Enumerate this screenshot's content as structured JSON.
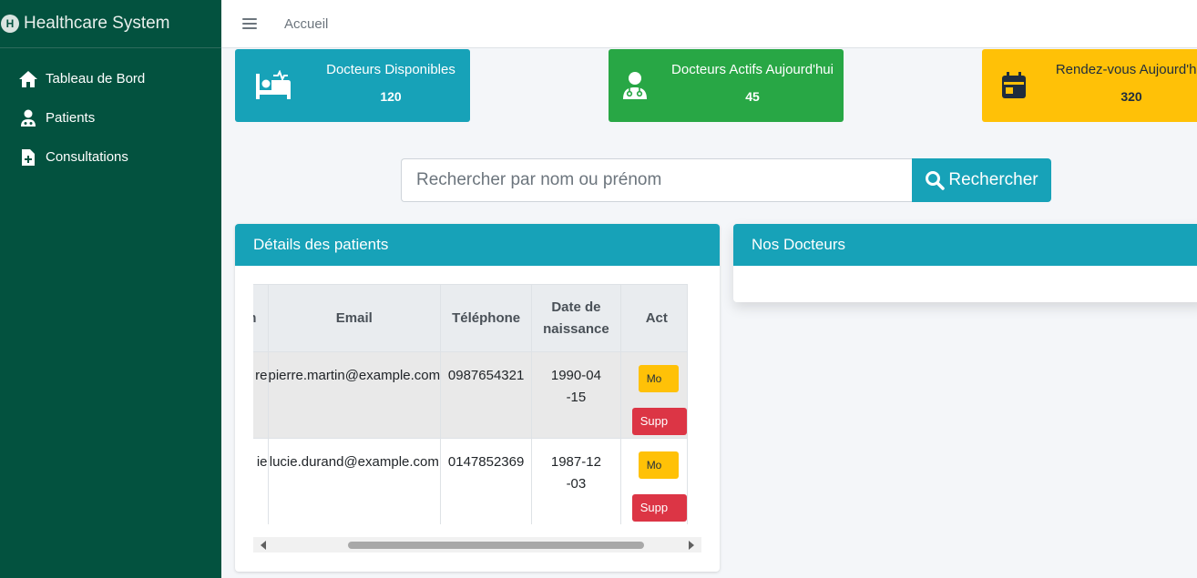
{
  "app": {
    "title": "Healthcare System",
    "logo_letter": "H"
  },
  "sidebar": {
    "items": [
      {
        "label": "Tableau de Bord",
        "icon": "home-icon"
      },
      {
        "label": "Patients",
        "icon": "user-doctor-icon"
      },
      {
        "label": "Consultations",
        "icon": "file-medical-icon"
      }
    ]
  },
  "topbar": {
    "menu_icon": "hamburger-icon",
    "home_label": "Accueil"
  },
  "stats": [
    {
      "label": "Docteurs Disponibles",
      "value": "120",
      "icon": "bed-patient-icon",
      "color": "#17a2b8"
    },
    {
      "label": "Docteurs Actifs Aujourd'hui",
      "value": "45",
      "icon": "user-doctor-icon",
      "color": "#28a745"
    },
    {
      "label": "Rendez-vous Aujourd'hui",
      "value": "320",
      "icon": "calendar-icon",
      "color": "#ffc107"
    }
  ],
  "search": {
    "placeholder": "Rechercher par nom ou prénom",
    "button_label": "Rechercher"
  },
  "patients_card": {
    "title": "Détails des patients",
    "columns": [
      "om",
      "Email",
      "Téléphone",
      "Date de naissance",
      "Act"
    ],
    "rows": [
      {
        "name": "re",
        "email": "pierre.martin@example.com",
        "phone": "0987654321",
        "dob": "1990-04-15",
        "modify_label": "Mo",
        "delete_label": "Supp"
      },
      {
        "name": "ie",
        "email": "lucie.durand@example.com",
        "phone": "0147852369",
        "dob": "1987-12-03",
        "modify_label": "Mo",
        "delete_label": "Supp"
      }
    ]
  },
  "doctors_card": {
    "title": "Nos Docteurs"
  },
  "colors": {
    "sidebar": "#03523f",
    "info": "#17a2b8",
    "success": "#28a745",
    "warning": "#ffc107",
    "danger": "#dc3545"
  }
}
